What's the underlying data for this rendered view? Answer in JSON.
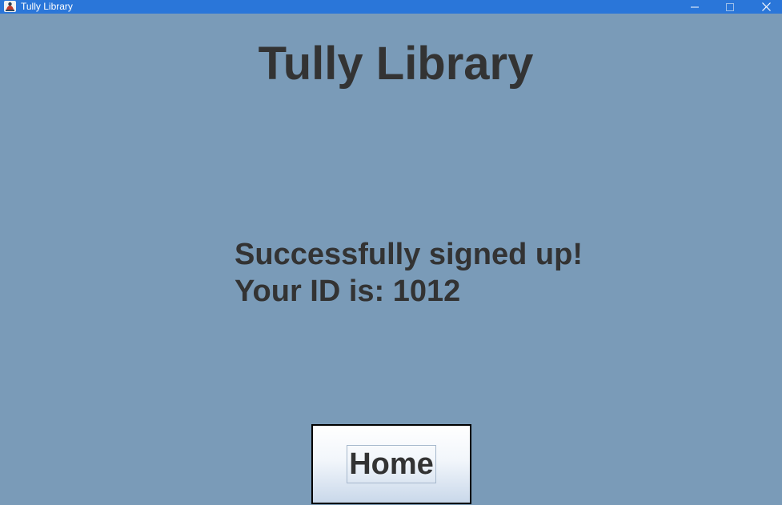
{
  "window": {
    "title": "Tully Library",
    "controls": {
      "minimize_icon": "minimize-icon",
      "maximize_icon": "maximize-icon",
      "close_icon": "close-icon"
    }
  },
  "main": {
    "heading": "Tully Library",
    "message_line1": "Successfully signed up!",
    "message_line2": "Your ID is: 1012",
    "home_button_label": "Home"
  },
  "colors": {
    "titlebar": "#2a76d9",
    "background": "#7a9bb8",
    "text": "#333333"
  }
}
